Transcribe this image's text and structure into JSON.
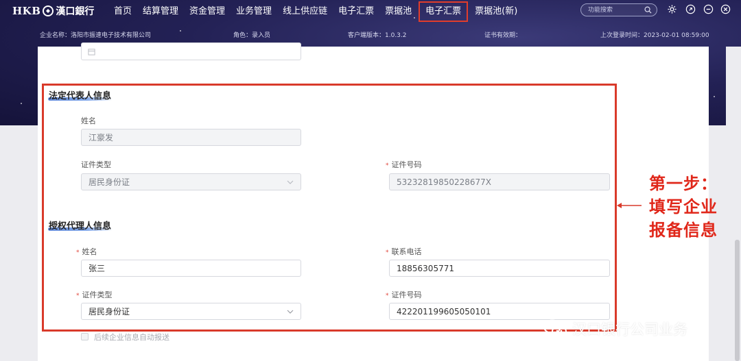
{
  "header": {
    "logo_latin": "HKB",
    "logo_cn": "漢口銀行",
    "nav": [
      "首页",
      "结算管理",
      "资金管理",
      "业务管理",
      "线上供应链",
      "电子汇票",
      "票据池",
      "电子汇票",
      "票据池(新)"
    ],
    "search_placeholder": "功能搜索",
    "info": {
      "company": "企业名称：洛阳市振速电子技术有限公司",
      "role": "角色：录入员",
      "client_version": "客户端版本：1.0.3.2",
      "cert_validity": "证书有效期：",
      "last_login": "上次登录时间：2023-02-01 08:59:00"
    }
  },
  "form": {
    "legal_rep": {
      "title": "法定代表人信息",
      "name_label": "姓名",
      "name_value": "江豪发",
      "id_type_label": "证件类型",
      "id_type_value": "居民身份证",
      "id_no_label": "证件号码",
      "id_no_value": "53232819850228677X"
    },
    "agent": {
      "title": "授权代理人信息",
      "name_label": "姓名",
      "name_value": "张三",
      "phone_label": "联系电话",
      "phone_value": "18856305771",
      "id_type_label": "证件类型",
      "id_type_value": "居民身份证",
      "id_no_label": "证件号码",
      "id_no_value": "422201199605050101"
    },
    "auto_report_label": "后续企业信息自动报送"
  },
  "annotation": {
    "line1": "第一步：",
    "line2": "填写企业",
    "line3": "报备信息",
    "color": "#e0271a"
  },
  "watermark": "汉口银行公司业务"
}
